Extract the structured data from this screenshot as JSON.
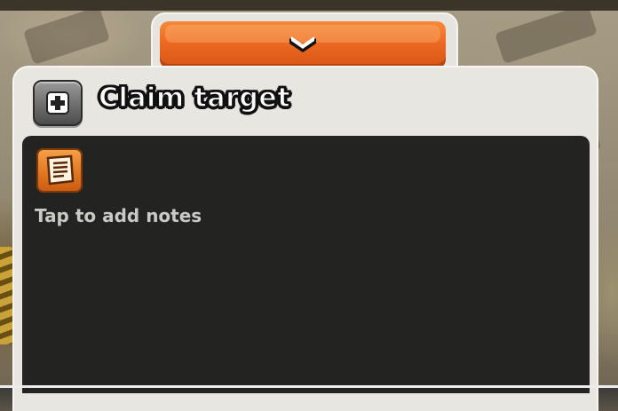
{
  "panel": {
    "title": "Claim target",
    "claim_icon": "plus-icon",
    "collapse_icon": "chevron-down-icon"
  },
  "notes": {
    "icon": "notes-icon",
    "placeholder": "Tap to add notes"
  },
  "colors": {
    "accent_orange": "#ec6a22",
    "panel_bg": "#e7e6e0",
    "notes_bg": "#232321",
    "notes_text": "#c9c9c6"
  }
}
